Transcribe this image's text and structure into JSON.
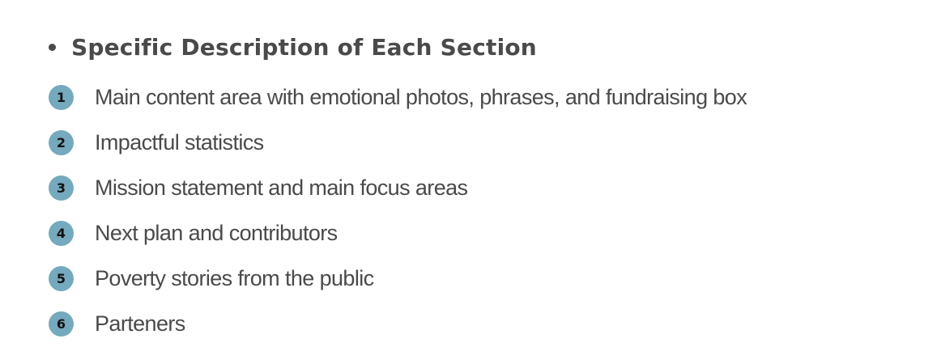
{
  "heading": "Specific Description of Each Section",
  "colors": {
    "badge": "#75a9bd",
    "text": "#4a4a4a"
  },
  "items": [
    {
      "number": "1",
      "text": "Main content area with emotional photos, phrases, and fundraising box"
    },
    {
      "number": "2",
      "text": "Impactful statistics"
    },
    {
      "number": "3",
      "text": "Mission statement and main focus areas"
    },
    {
      "number": "4",
      "text": "Next plan and contributors"
    },
    {
      "number": "5",
      "text": "Poverty stories from the public"
    },
    {
      "number": "6",
      "text": "Parteners"
    }
  ]
}
